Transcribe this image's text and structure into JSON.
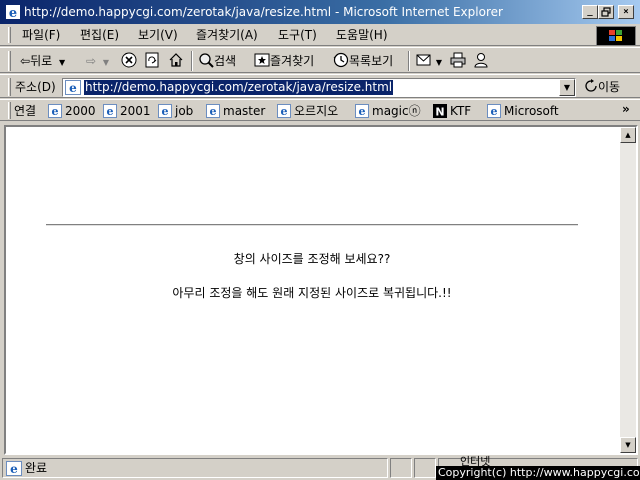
{
  "window": {
    "title": "http://demo.happycgi.com/zerotak/java/resize.html - Microsoft Internet Explorer",
    "minimize_label": "_",
    "maximize_label": "🗗",
    "close_label": "×"
  },
  "menu": {
    "items": [
      {
        "label": "파일(F)"
      },
      {
        "label": "편집(E)"
      },
      {
        "label": "보기(V)"
      },
      {
        "label": "즐겨찾기(A)"
      },
      {
        "label": "도구(T)"
      },
      {
        "label": "도움말(H)"
      }
    ]
  },
  "toolbar": {
    "back_label": "뒤로",
    "search_label": "검색",
    "favorites_label": "즐겨찾기",
    "history_label": "목록보기"
  },
  "address": {
    "label": "주소(D)",
    "value": "http://demo.happycgi.com/zerotak/java/resize.html",
    "go_label": "이동"
  },
  "links": {
    "label": "연결",
    "items": [
      {
        "label": "2000",
        "icon": "ie-page-icon"
      },
      {
        "label": "2001",
        "icon": "ie-page-icon"
      },
      {
        "label": "job",
        "icon": "ie-page-icon"
      },
      {
        "label": "master",
        "icon": "ie-page-icon"
      },
      {
        "label": "오르지오",
        "icon": "ie-page-icon"
      },
      {
        "label": "magicⓝ",
        "icon": "ie-page-icon"
      },
      {
        "label": "KTF",
        "icon": "n-logo-icon"
      },
      {
        "label": "Microsoft",
        "icon": "ie-page-icon"
      }
    ],
    "more_label": "»"
  },
  "page": {
    "line1": "창의 사이즈를 조정해 보세요??",
    "line2": "아무리 조정을 해도 원래 지정된 사이즈로 복귀됩니다.!!"
  },
  "status": {
    "text": "완료",
    "zone_label": "인터넷",
    "copyright": "Copyright(c) http://www.happycgi.com"
  },
  "colors": {
    "title_bar": "#0a246a",
    "chrome": "#d4d0c8",
    "selection": "#0a246a"
  }
}
